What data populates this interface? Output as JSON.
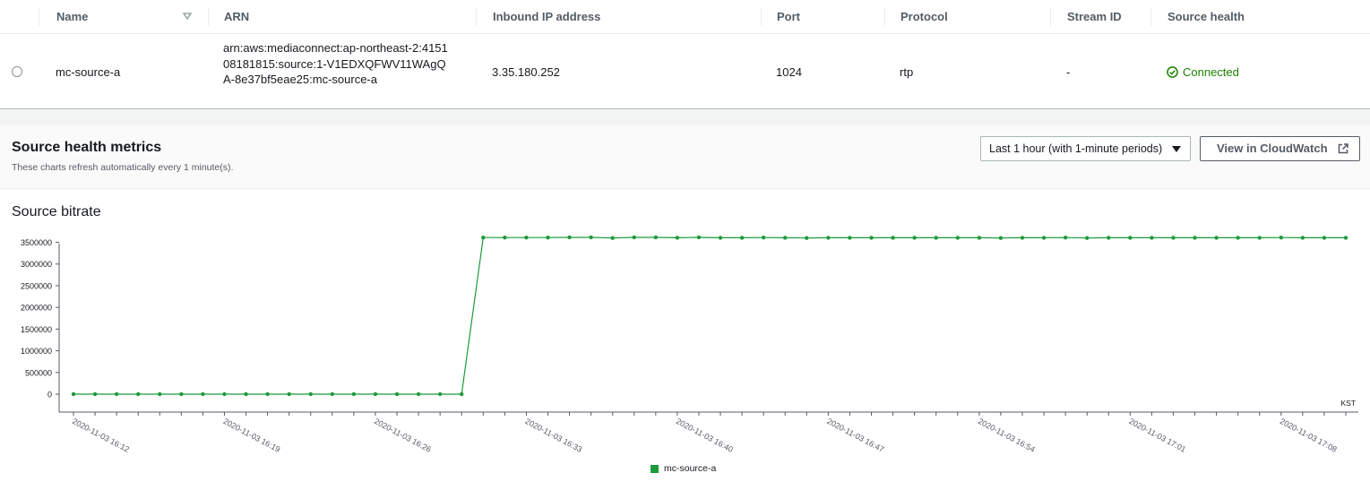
{
  "table": {
    "headers": {
      "name": "Name",
      "arn": "ARN",
      "ip": "Inbound IP address",
      "port": "Port",
      "protocol": "Protocol",
      "stream_id": "Stream ID",
      "health": "Source health"
    },
    "row": {
      "name": "mc-source-a",
      "arn": "arn:aws:mediaconnect:ap-northeast-2:415108181815:source:1-V1EDXQFWV11WAgQA-8e37bf5eae25:mc-source-a",
      "ip": "3.35.180.252",
      "port": "1024",
      "protocol": "rtp",
      "stream_id": "-",
      "health": "Connected"
    }
  },
  "metrics": {
    "title": "Source health metrics",
    "subtitle": "These charts refresh automatically every 1 minute(s).",
    "range_label": "Last 1 hour (with 1-minute periods)",
    "cloudwatch_label": "View in CloudWatch"
  },
  "colors": {
    "series": "#1d9a3a",
    "health_ok": "#1d8102"
  },
  "icons": {
    "sort": "sort-down-icon",
    "health": "check-circle-icon",
    "external": "external-link-icon"
  },
  "chart_data": {
    "type": "line",
    "title": "Source bitrate",
    "timezone": "KST",
    "y_ticks": [
      "0",
      "500000",
      "1000000",
      "1500000",
      "2000000",
      "2500000",
      "3000000",
      "3500000"
    ],
    "ylim": [
      0,
      3800000
    ],
    "x_start": "2020-11-03 16:12",
    "x_tick_labels": [
      "2020-11-03 16:12",
      "2020-11-03 16:19",
      "2020-11-03 16:26",
      "2020-11-03 16:33",
      "2020-11-03 16:40",
      "2020-11-03 16:47",
      "2020-11-03 16:54",
      "2020-11-03 17:01",
      "2020-11-03 17:08"
    ],
    "series": [
      {
        "name": "mc-source-a",
        "x": [
          "2020-11-03 16:12",
          "2020-11-03 16:13",
          "2020-11-03 16:14",
          "2020-11-03 16:15",
          "2020-11-03 16:16",
          "2020-11-03 16:17",
          "2020-11-03 16:18",
          "2020-11-03 16:19",
          "2020-11-03 16:20",
          "2020-11-03 16:21",
          "2020-11-03 16:22",
          "2020-11-03 16:23",
          "2020-11-03 16:24",
          "2020-11-03 16:25",
          "2020-11-03 16:26",
          "2020-11-03 16:27",
          "2020-11-03 16:28",
          "2020-11-03 16:29",
          "2020-11-03 16:30",
          "2020-11-03 16:31",
          "2020-11-03 16:32",
          "2020-11-03 16:33",
          "2020-11-03 16:34",
          "2020-11-03 16:35",
          "2020-11-03 16:36",
          "2020-11-03 16:37",
          "2020-11-03 16:38",
          "2020-11-03 16:39",
          "2020-11-03 16:40",
          "2020-11-03 16:41",
          "2020-11-03 16:42",
          "2020-11-03 16:43",
          "2020-11-03 16:44",
          "2020-11-03 16:45",
          "2020-11-03 16:46",
          "2020-11-03 16:47",
          "2020-11-03 16:48",
          "2020-11-03 16:49",
          "2020-11-03 16:50",
          "2020-11-03 16:51",
          "2020-11-03 16:52",
          "2020-11-03 16:53",
          "2020-11-03 16:54",
          "2020-11-03 16:55",
          "2020-11-03 16:56",
          "2020-11-03 16:57",
          "2020-11-03 16:58",
          "2020-11-03 16:59",
          "2020-11-03 17:00",
          "2020-11-03 17:01",
          "2020-11-03 17:02",
          "2020-11-03 17:03",
          "2020-11-03 17:04",
          "2020-11-03 17:05",
          "2020-11-03 17:06",
          "2020-11-03 17:07",
          "2020-11-03 17:08",
          "2020-11-03 17:09",
          "2020-11-03 17:10",
          "2020-11-03 17:11"
        ],
        "values": [
          0,
          0,
          0,
          0,
          0,
          0,
          0,
          0,
          0,
          0,
          0,
          0,
          0,
          0,
          0,
          0,
          0,
          0,
          0,
          3610000,
          3610000,
          3610000,
          3610000,
          3615000,
          3615000,
          3600000,
          3615000,
          3615000,
          3605000,
          3615000,
          3605000,
          3605000,
          3610000,
          3605000,
          3600000,
          3605000,
          3605000,
          3605000,
          3605000,
          3605000,
          3605000,
          3605000,
          3605000,
          3600000,
          3605000,
          3605000,
          3610000,
          3600000,
          3605000,
          3605000,
          3605000,
          3605000,
          3605000,
          3605000,
          3605000,
          3605000,
          3610000,
          3605000,
          3605000,
          3605000
        ]
      }
    ]
  }
}
